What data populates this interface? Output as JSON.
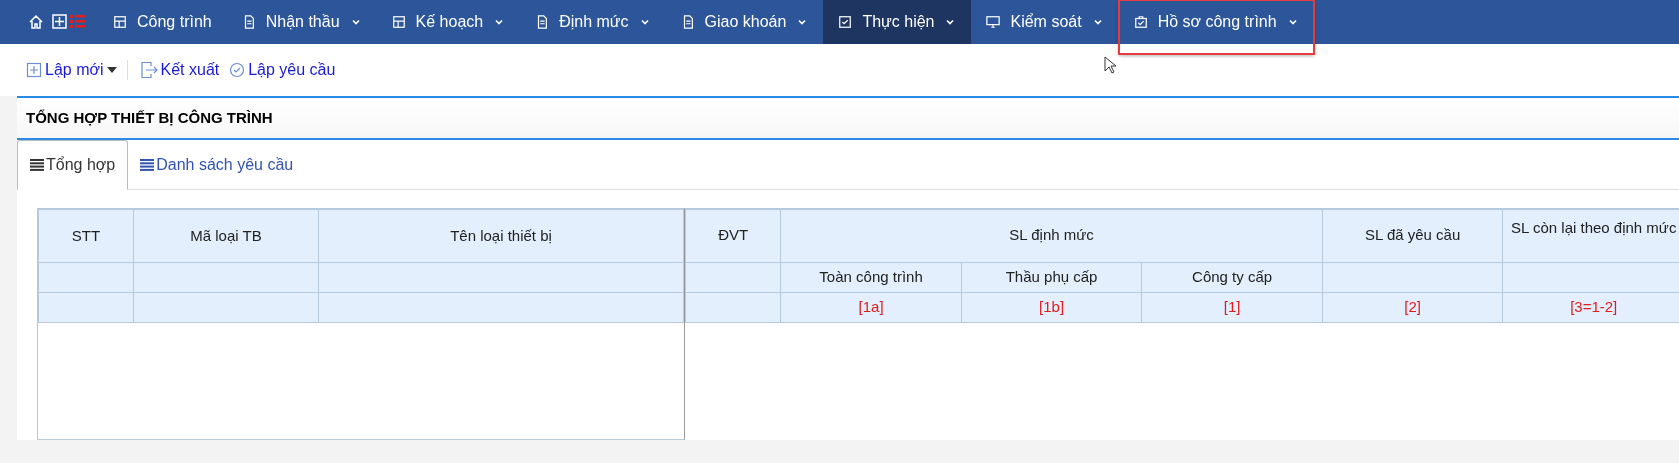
{
  "nav": {
    "items": [
      {
        "kind": "home"
      },
      {
        "kind": "grid"
      },
      {
        "kind": "menu",
        "label": "Công trình",
        "dropdown": false,
        "selected": false,
        "highlighted": false
      },
      {
        "kind": "menu",
        "label": "Nhận thầu",
        "dropdown": true,
        "selected": false,
        "highlighted": false
      },
      {
        "kind": "menu",
        "label": "Kế hoạch",
        "dropdown": true,
        "selected": false,
        "highlighted": false
      },
      {
        "kind": "menu",
        "label": "Định mức",
        "dropdown": true,
        "selected": false,
        "highlighted": false
      },
      {
        "kind": "menu",
        "label": "Giao khoán",
        "dropdown": true,
        "selected": false,
        "highlighted": false
      },
      {
        "kind": "menu",
        "label": "Thực hiện",
        "dropdown": true,
        "selected": true,
        "highlighted": false
      },
      {
        "kind": "menu",
        "label": "Kiểm soát",
        "dropdown": true,
        "selected": false,
        "highlighted": false
      },
      {
        "kind": "menu",
        "label": "Hồ sơ công trình",
        "dropdown": true,
        "selected": false,
        "highlighted": true
      }
    ]
  },
  "toolbar": [
    {
      "label": "Lập mới",
      "dropdown": true
    },
    {
      "label": "Kết xuất",
      "dropdown": false
    },
    {
      "label": "Lập yêu cầu",
      "dropdown": false
    }
  ],
  "title": "TỔNG HỢP THIẾT BỊ CÔNG TRÌNH",
  "tabs": [
    {
      "label": "Tổng hợp",
      "selected": true
    },
    {
      "label": "Danh sách yêu cầu",
      "selected": false
    }
  ],
  "left_table": {
    "columns": [
      "STT",
      "Mã loại TB",
      "Tên loại thiết bị"
    ]
  },
  "right_table": {
    "dvt": "ĐVT",
    "group": "SL định mức",
    "sub_columns": [
      "Toàn công trình",
      "Thầu phụ cấp",
      "Công ty cấp"
    ],
    "col_requested": "SL đã yêu cầu",
    "col_remaining": "SL còn lại theo định mức",
    "codes": [
      "[1a]",
      "[1b]",
      "[1]",
      "[2]",
      "[3=1-2]"
    ]
  }
}
